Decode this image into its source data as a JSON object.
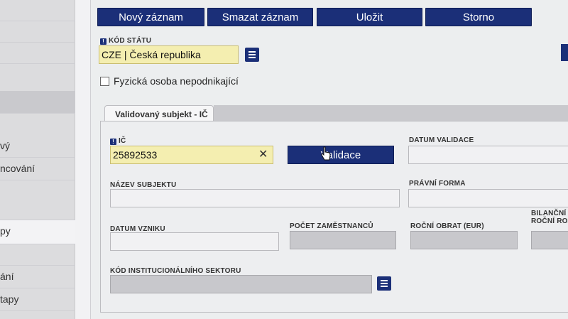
{
  "sidebar": {
    "items": [
      {
        "label": ""
      },
      {
        "label": ""
      },
      {
        "label": ""
      },
      {
        "label": ""
      },
      {
        "label": "vý"
      },
      {
        "label": "ncování"
      },
      {
        "label": ""
      },
      {
        "label": "py"
      },
      {
        "label": ""
      },
      {
        "label": "ání"
      },
      {
        "label": "tapy"
      }
    ]
  },
  "toolbar": {
    "new_label": "Nový záznam",
    "delete_label": "Smazat záznam",
    "save_label": "Uložit",
    "cancel_label": "Storno"
  },
  "form": {
    "country_label": "KÓD STÁTU",
    "country_value": "CZE | Česká republika",
    "nonbusiness_label": "Fyzická osoba nepodnikající",
    "nonbusiness_checked": false
  },
  "panel": {
    "tab_label": "Validovaný subjekt - IČ",
    "ic_label": "IČ",
    "ic_value": "25892533",
    "clear_symbol": "✕",
    "validate_label": "Validace",
    "validation_date_label": "DATUM VALIDACE",
    "subject_name_label": "NÁZEV SUBJEKTU",
    "legal_form_label": "PRÁVNÍ FORMA",
    "founding_date_label": "DATUM VZNIKU",
    "employees_label": "POČET ZAMĚSTNANCŮ",
    "turnover_label": "ROČNÍ OBRAT (EUR)",
    "balance_label_1": "BILANČNÍ S",
    "balance_label_2": "ROČNÍ ROZV",
    "sector_label": "KÓD INSTITUCIONÁLNÍHO SEKTORU"
  },
  "icons": {
    "required": "exclamation-icon",
    "list": "list-icon",
    "cursor": "hand-cursor-icon"
  },
  "colors": {
    "primary_button": "#1b2f78",
    "required_field": "#f4eeb0",
    "readonly_field": "#c8c8cc"
  }
}
